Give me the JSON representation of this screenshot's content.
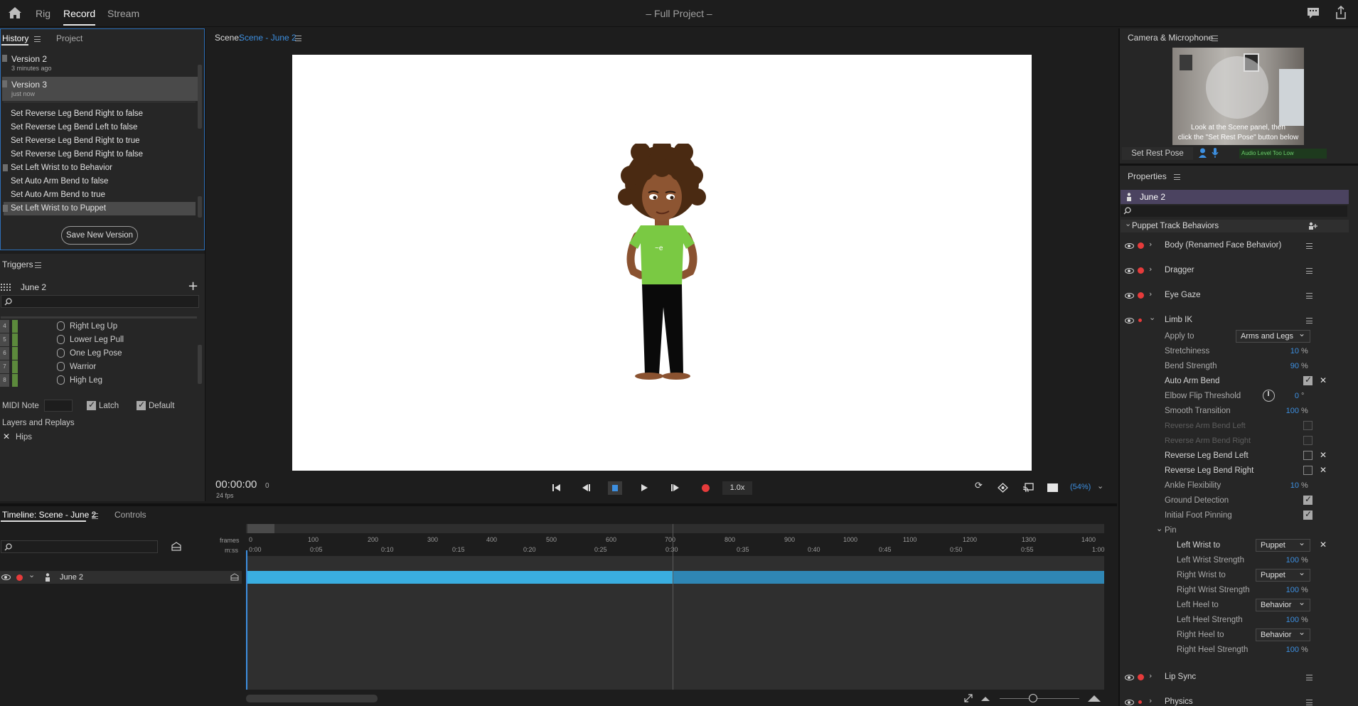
{
  "topbar": {
    "tabs": [
      "Rig",
      "Record",
      "Stream"
    ],
    "active_tab": "Record",
    "project_title": "– Full Project –"
  },
  "history": {
    "tabs": [
      "History",
      "Project"
    ],
    "versions": [
      {
        "name": "Version 2",
        "time": "3 minutes ago"
      },
      {
        "name": "Version 3",
        "time": "just now"
      }
    ],
    "items": [
      "Set Reverse Leg Bend Right to false",
      "Set Reverse Leg Bend Left to false",
      "Set Reverse Leg Bend Right to true",
      "Set Reverse Leg Bend Right to false",
      "Set Left Wrist to to Behavior",
      "Set Auto Arm Bend to false",
      "Set Auto Arm Bend to true",
      "Set Left Wrist to to Puppet"
    ],
    "save_button": "Save New Version"
  },
  "triggers": {
    "title": "Triggers",
    "puppet": "June 2",
    "items": [
      {
        "num": "4",
        "label": "Right Leg Up"
      },
      {
        "num": "5",
        "label": "Lower Leg Pull"
      },
      {
        "num": "6",
        "label": "One Leg Pose"
      },
      {
        "num": "7",
        "label": "Warrior"
      },
      {
        "num": "8",
        "label": "High Leg"
      }
    ],
    "midi_label": "MIDI Note",
    "latch_label": "Latch",
    "default_label": "Default",
    "layers_label": "Layers and Replays",
    "layer_item": "Hips"
  },
  "scene": {
    "label": "Scene:",
    "name": "Scene - June 2",
    "timecode": "00:00:00",
    "frame": "0",
    "fps": "24 fps",
    "speed": "1.0x",
    "zoom": "(54%)"
  },
  "timeline": {
    "tabs": [
      "Timeline: Scene - June 2",
      "Controls"
    ],
    "frames_label": "frames",
    "mss_label": "m:ss",
    "frame_ticks": [
      "0",
      "100",
      "200",
      "300",
      "400",
      "500",
      "600",
      "700",
      "800",
      "900",
      "1000",
      "1100",
      "1200",
      "1300",
      "1400"
    ],
    "time_ticks": [
      "0:00",
      "0:05",
      "0:10",
      "0:15",
      "0:20",
      "0:25",
      "0:30",
      "0:35",
      "0:40",
      "0:45",
      "0:50",
      "0:55",
      "1:00"
    ],
    "track_name": "June 2"
  },
  "camera": {
    "title": "Camera & Microphone",
    "overlay_text_1": "Look at the Scene panel, then",
    "overlay_text_2": "click the \"Set Rest Pose\" button below",
    "set_rest_pose": "Set Rest Pose",
    "audio_level": "Audio Level Too Low"
  },
  "properties": {
    "title": "Properties",
    "puppet": "June 2",
    "section": "Puppet Track Behaviors",
    "behaviors_top": [
      "Body (Renamed Face Behavior)",
      "Dragger",
      "Eye Gaze",
      "Limb IK"
    ],
    "limb_ik": {
      "apply_to_label": "Apply to",
      "apply_to_value": "Arms and Legs",
      "stretchiness_label": "Stretchiness",
      "stretchiness": "10",
      "bend_strength_label": "Bend Strength",
      "bend_strength": "90",
      "auto_arm_bend": "Auto Arm Bend",
      "elbow_flip_label": "Elbow Flip Threshold",
      "elbow_flip": "0",
      "smooth_label": "Smooth Transition",
      "smooth": "100",
      "rev_arm_left": "Reverse Arm Bend Left",
      "rev_arm_right": "Reverse Arm Bend Right",
      "rev_leg_left": "Reverse Leg Bend Left",
      "rev_leg_right": "Reverse Leg Bend Right",
      "ankle_label": "Ankle Flexibility",
      "ankle": "10",
      "ground_detection": "Ground Detection",
      "initial_foot": "Initial Foot Pinning",
      "pin": "Pin",
      "left_wrist_label": "Left Wrist to",
      "left_wrist": "Puppet",
      "left_wrist_strength_label": "Left Wrist Strength",
      "left_wrist_strength": "100",
      "right_wrist_label": "Right Wrist to",
      "right_wrist": "Puppet",
      "right_wrist_strength_label": "Right Wrist Strength",
      "right_wrist_strength": "100",
      "left_heel_label": "Left Heel to",
      "left_heel": "Behavior",
      "left_heel_strength_label": "Left Heel Strength",
      "left_heel_strength": "100",
      "right_heel_label": "Right Heel to",
      "right_heel": "Behavior",
      "right_heel_strength_label": "Right Heel Strength",
      "right_heel_strength": "100"
    },
    "behaviors_bottom": [
      "Lip Sync",
      "Physics"
    ],
    "percent": "%",
    "degree": "°"
  },
  "colors": {
    "accent": "#3d8fe0",
    "track": "#3aaee0",
    "puppet_header": "#4b4360",
    "record": "#e63b3b"
  }
}
